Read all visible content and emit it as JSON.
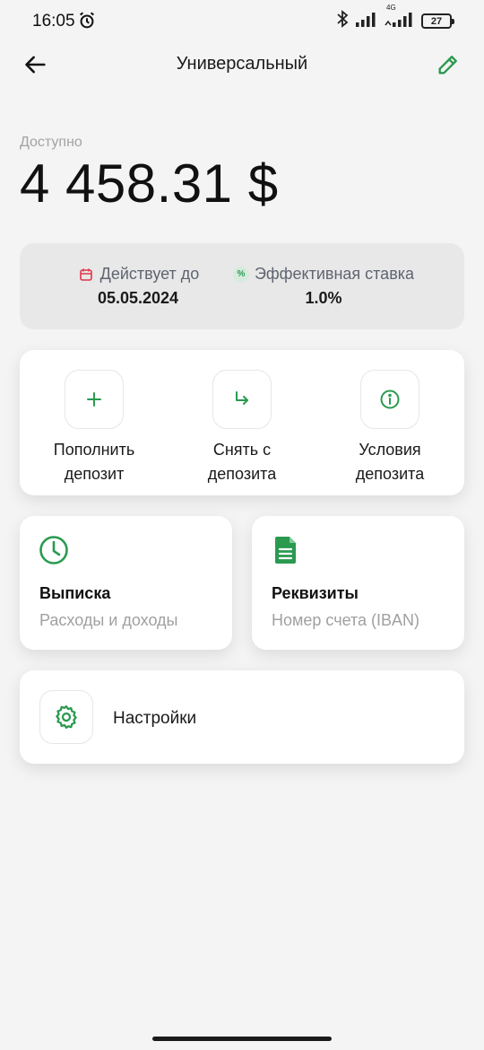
{
  "status": {
    "time": "16:05",
    "network": "4G",
    "battery": "27"
  },
  "header": {
    "title": "Универсальный"
  },
  "balance": {
    "label": "Доступно",
    "amount": "4 458.31 $"
  },
  "info": {
    "valid_until_label": "Действует до",
    "valid_until_value": "05.05.2024",
    "rate_label": "Эффективная ставка",
    "rate_value": "1.0%",
    "rate_icon_glyph": "%"
  },
  "actions": [
    {
      "label_line1": "Пополнить",
      "label_line2": "депозит",
      "icon": "plus-icon"
    },
    {
      "label_line1": "Снять с",
      "label_line2": "депозита",
      "icon": "withdraw-arrow-icon"
    },
    {
      "label_line1": "Условия",
      "label_line2": "депозита",
      "icon": "info-icon"
    }
  ],
  "tiles": {
    "statement": {
      "title": "Выписка",
      "subtitle": "Расходы и доходы",
      "icon": "clock-icon"
    },
    "requisites": {
      "title": "Реквизиты",
      "subtitle": "Номер счета (IBAN)",
      "icon": "document-icon"
    }
  },
  "settings": {
    "label": "Настройки",
    "icon": "gear-icon"
  },
  "colors": {
    "accent_green": "#2a9a4f",
    "calendar_red": "#e0354a",
    "background": "#f4f4f4"
  }
}
